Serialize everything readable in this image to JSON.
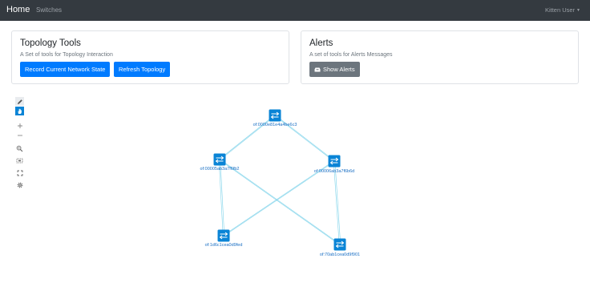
{
  "navbar": {
    "brand": "Home",
    "links": [
      "Switches"
    ],
    "user": "Kitten User"
  },
  "topology_tools": {
    "title": "Topology Tools",
    "subtitle": "A Set of tools for Topology Interaction",
    "record_label": "Record Current Network State",
    "refresh_label": "Refresh Topology"
  },
  "alerts": {
    "title": "Alerts",
    "subtitle": "A set of tools for Alerts Messages",
    "show_label": "Show Alerts"
  },
  "toolbar": {
    "tools": [
      "pencil-icon",
      "hand-icon",
      "zoom-in-icon",
      "zoom-out-icon",
      "zoom-fit-icon",
      "select-area-icon",
      "fullscreen-icon",
      "gear-icon"
    ]
  },
  "colors": {
    "navbar": "#343a40",
    "primary": "#007bff",
    "secondary": "#6c757d",
    "node": "#0a84d6",
    "link": "#7fd3ea"
  },
  "topology": {
    "nodes": [
      {
        "id": "n1",
        "label": "of:0000e81e4a4be6c3"
      },
      {
        "id": "n2",
        "label": "of:00005ab3a7f6fb2"
      },
      {
        "id": "n3",
        "label": "of:00006ab3a7f6b6d"
      },
      {
        "id": "n4",
        "label": "of:1d6c1cea0d9fed"
      },
      {
        "id": "n5",
        "label": "of:70ab1cea0d9f901"
      }
    ],
    "links": [
      [
        "n1",
        "n2"
      ],
      [
        "n1",
        "n3"
      ],
      [
        "n2",
        "n4"
      ],
      [
        "n2",
        "n5"
      ],
      [
        "n3",
        "n4"
      ],
      [
        "n3",
        "n5"
      ]
    ]
  }
}
